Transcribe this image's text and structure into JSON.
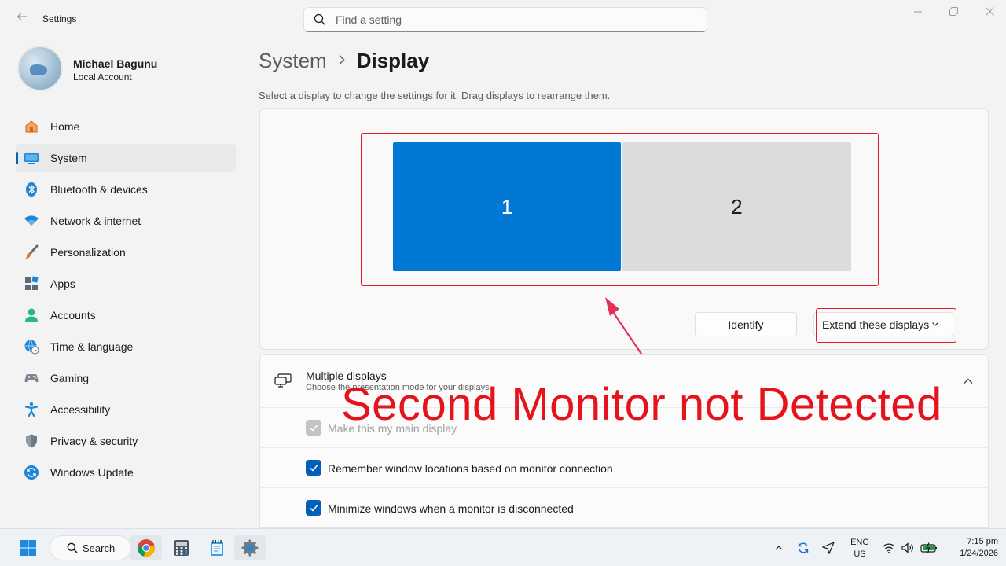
{
  "window": {
    "app_title": "Settings",
    "back_icon": "back-arrow-icon",
    "search_placeholder": "Find a setting"
  },
  "profile": {
    "name": "Michael Bagunu",
    "account_type": "Local Account"
  },
  "sidebar": {
    "items": [
      {
        "label": "Home",
        "icon": "home-icon"
      },
      {
        "label": "System",
        "icon": "system-icon",
        "active": true
      },
      {
        "label": "Bluetooth & devices",
        "icon": "bluetooth-icon"
      },
      {
        "label": "Network & internet",
        "icon": "wifi-icon"
      },
      {
        "label": "Personalization",
        "icon": "brush-icon"
      },
      {
        "label": "Apps",
        "icon": "apps-icon"
      },
      {
        "label": "Accounts",
        "icon": "accounts-icon"
      },
      {
        "label": "Time & language",
        "icon": "globe-clock-icon"
      },
      {
        "label": "Gaming",
        "icon": "gamepad-icon"
      },
      {
        "label": "Accessibility",
        "icon": "accessibility-icon"
      },
      {
        "label": "Privacy & security",
        "icon": "shield-icon"
      },
      {
        "label": "Windows Update",
        "icon": "update-icon"
      }
    ]
  },
  "main": {
    "breadcrumb": {
      "parent": "System",
      "current": "Display"
    },
    "helper_text": "Select a display to change the settings for it. Drag displays to rearrange them.",
    "monitors": [
      {
        "label": "1",
        "selected": true
      },
      {
        "label": "2",
        "selected": false
      }
    ],
    "identify_label": "Identify",
    "display_mode": {
      "selected": "Extend these displays"
    },
    "multiple_displays": {
      "title": "Multiple displays",
      "subtitle": "Choose the presentation mode for your displays",
      "expanded": true,
      "options": [
        {
          "label": "Make this my main display",
          "checked": true,
          "disabled": true
        },
        {
          "label": "Remember window locations based on monitor connection",
          "checked": true,
          "disabled": false
        },
        {
          "label": "Minimize windows when a monitor is disconnected",
          "checked": true,
          "disabled": false
        }
      ]
    }
  },
  "annotation": {
    "title": "Second Monitor not Detected",
    "color": "#e5141c"
  },
  "taskbar": {
    "search_label": "Search",
    "pinned": [
      "windows-start-icon",
      "chrome-icon",
      "calculator-icon",
      "notepad-icon",
      "settings-gear-icon"
    ],
    "tray": {
      "lang_top": "ENG",
      "lang_bottom": "US",
      "time": "7:15 pm",
      "date": "1/24/2026"
    }
  },
  "colors": {
    "accent": "#005fb8",
    "monitor_selected": "#0078d4",
    "monitor_unselected": "#dcdcdc",
    "highlight_red": "#e21b2b"
  }
}
